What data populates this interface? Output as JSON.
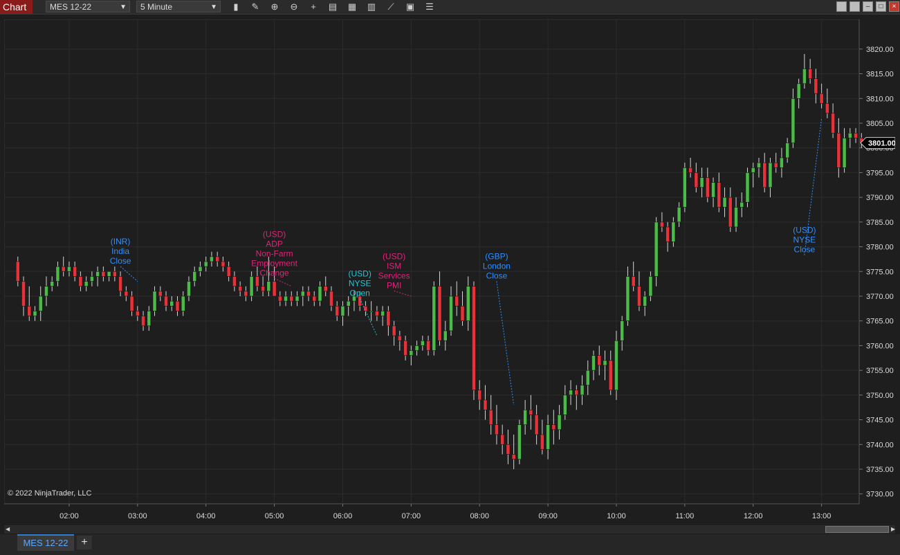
{
  "toolbar": {
    "title": "Chart",
    "instrument": "MES 12-22",
    "interval": "5 Minute"
  },
  "icons": [
    "bar-type-icon",
    "pencil-icon",
    "zoom-in-icon",
    "zoom-out-icon",
    "crosshair-icon",
    "properties-icon",
    "templates-icon",
    "indicators-icon",
    "strategies-icon",
    "data-box-icon",
    "list-icon"
  ],
  "chart_data": {
    "type": "candlestick",
    "instrument": "MES 12-22",
    "interval": "5 Minute",
    "current_price": "3801.00",
    "copyright": "© 2022 NinjaTrader, LLC",
    "ylim": [
      3728,
      3826
    ],
    "y_ticks": [
      "3730.00",
      "3735.00",
      "3740.00",
      "3745.00",
      "3750.00",
      "3755.00",
      "3760.00",
      "3765.00",
      "3770.00",
      "3775.00",
      "3780.00",
      "3785.00",
      "3790.00",
      "3795.00",
      "3800.00",
      "3805.00",
      "3810.00",
      "3815.00",
      "3820.00"
    ],
    "x_ticks": [
      "02:00",
      "03:00",
      "04:00",
      "05:00",
      "06:00",
      "07:00",
      "08:00",
      "09:00",
      "10:00",
      "11:00",
      "12:00",
      "13:00"
    ],
    "x_tick_times": [
      2,
      3,
      4,
      5,
      6,
      7,
      8,
      9,
      10,
      11,
      12,
      13
    ],
    "first_bar_time": 1.25,
    "bar_minutes": 5,
    "grid": true,
    "candles": [
      [
        3777,
        3778,
        3772,
        3773
      ],
      [
        3773,
        3774,
        3766,
        3768
      ],
      [
        3768,
        3772,
        3765,
        3766
      ],
      [
        3766,
        3768,
        3765,
        3767
      ],
      [
        3767,
        3772,
        3765,
        3770
      ],
      [
        3770,
        3774,
        3768,
        3772
      ],
      [
        3772,
        3774,
        3771,
        3773
      ],
      [
        3773,
        3777,
        3772,
        3776
      ],
      [
        3776,
        3778,
        3774,
        3775
      ],
      [
        3775,
        3777,
        3774,
        3776
      ],
      [
        3776,
        3777,
        3773,
        3774
      ],
      [
        3774,
        3775,
        3771,
        3772
      ],
      [
        3772,
        3774,
        3771,
        3773
      ],
      [
        3773,
        3775,
        3772,
        3774
      ],
      [
        3774,
        3776,
        3772,
        3775
      ],
      [
        3775,
        3776,
        3773,
        3774
      ],
      [
        3774,
        3775,
        3773,
        3775
      ],
      [
        3775,
        3776,
        3773,
        3774
      ],
      [
        3774,
        3775,
        3770,
        3771
      ],
      [
        3771,
        3772,
        3769,
        3770
      ],
      [
        3770,
        3771,
        3766,
        3767
      ],
      [
        3767,
        3768,
        3765,
        3766
      ],
      [
        3766,
        3767,
        3763,
        3764
      ],
      [
        3764,
        3768,
        3763,
        3767
      ],
      [
        3767,
        3772,
        3766,
        3771
      ],
      [
        3771,
        3772,
        3769,
        3770
      ],
      [
        3770,
        3771,
        3767,
        3768
      ],
      [
        3768,
        3770,
        3767,
        3769
      ],
      [
        3769,
        3770,
        3766,
        3767
      ],
      [
        3767,
        3771,
        3766,
        3770
      ],
      [
        3770,
        3774,
        3769,
        3773
      ],
      [
        3773,
        3776,
        3772,
        3775
      ],
      [
        3775,
        3777,
        3774,
        3776
      ],
      [
        3776,
        3778,
        3775,
        3777
      ],
      [
        3777,
        3779,
        3776,
        3778
      ],
      [
        3778,
        3779,
        3776,
        3777
      ],
      [
        3777,
        3778,
        3775,
        3776
      ],
      [
        3776,
        3777,
        3773,
        3774
      ],
      [
        3774,
        3775,
        3771,
        3772
      ],
      [
        3772,
        3773,
        3770,
        3771
      ],
      [
        3771,
        3772,
        3769,
        3770
      ],
      [
        3770,
        3775,
        3769,
        3774
      ],
      [
        3774,
        3776,
        3771,
        3772
      ],
      [
        3772,
        3774,
        3770,
        3771
      ],
      [
        3771,
        3778,
        3770,
        3773
      ],
      [
        3773,
        3776,
        3770,
        3770
      ],
      [
        3770,
        3771,
        3768,
        3769
      ],
      [
        3769,
        3771,
        3768,
        3770
      ],
      [
        3770,
        3771,
        3768,
        3769
      ],
      [
        3769,
        3771,
        3768,
        3770
      ],
      [
        3770,
        3772,
        3768,
        3771
      ],
      [
        3771,
        3772,
        3769,
        3770
      ],
      [
        3770,
        3771,
        3768,
        3769
      ],
      [
        3769,
        3773,
        3768,
        3772
      ],
      [
        3772,
        3774,
        3770,
        3771
      ],
      [
        3771,
        3772,
        3767,
        3768
      ],
      [
        3768,
        3769,
        3765,
        3766
      ],
      [
        3766,
        3769,
        3764,
        3768
      ],
      [
        3768,
        3770,
        3766,
        3769
      ],
      [
        3769,
        3771,
        3767,
        3770
      ],
      [
        3770,
        3771,
        3767,
        3768
      ],
      [
        3768,
        3769,
        3766,
        3767
      ],
      [
        3767,
        3769,
        3765,
        3767
      ],
      [
        3767,
        3768,
        3765,
        3766
      ],
      [
        3766,
        3768,
        3764,
        3767
      ],
      [
        3767,
        3768,
        3762,
        3764
      ],
      [
        3764,
        3765,
        3760,
        3762
      ],
      [
        3762,
        3763,
        3759,
        3761
      ],
      [
        3761,
        3762,
        3757,
        3758
      ],
      [
        3758,
        3760,
        3756,
        3759
      ],
      [
        3759,
        3761,
        3758,
        3760
      ],
      [
        3760,
        3762,
        3759,
        3761
      ],
      [
        3761,
        3762,
        3758,
        3759
      ],
      [
        3759,
        3773,
        3758,
        3772
      ],
      [
        3772,
        3775,
        3760,
        3761
      ],
      [
        3761,
        3765,
        3759,
        3763
      ],
      [
        3763,
        3772,
        3762,
        3770
      ],
      [
        3770,
        3773,
        3766,
        3768
      ],
      [
        3768,
        3771,
        3764,
        3765
      ],
      [
        3765,
        3774,
        3763,
        3772
      ],
      [
        3772,
        3773,
        3749,
        3751
      ],
      [
        3751,
        3753,
        3747,
        3749
      ],
      [
        3749,
        3752,
        3745,
        3747
      ],
      [
        3747,
        3750,
        3742,
        3744
      ],
      [
        3744,
        3748,
        3740,
        3742
      ],
      [
        3742,
        3744,
        3738,
        3740
      ],
      [
        3740,
        3743,
        3736,
        3738
      ],
      [
        3738,
        3742,
        3735,
        3737
      ],
      [
        3737,
        3745,
        3736,
        3744
      ],
      [
        3744,
        3749,
        3742,
        3747
      ],
      [
        3747,
        3750,
        3743,
        3746
      ],
      [
        3746,
        3748,
        3740,
        3742
      ],
      [
        3742,
        3745,
        3738,
        3739
      ],
      [
        3739,
        3746,
        3737,
        3744
      ],
      [
        3744,
        3747,
        3740,
        3743
      ],
      [
        3743,
        3748,
        3741,
        3746
      ],
      [
        3746,
        3752,
        3745,
        3750
      ],
      [
        3750,
        3753,
        3748,
        3751
      ],
      [
        3751,
        3752,
        3747,
        3750
      ],
      [
        3750,
        3754,
        3748,
        3752
      ],
      [
        3752,
        3757,
        3750,
        3755
      ],
      [
        3755,
        3759,
        3753,
        3758
      ],
      [
        3758,
        3760,
        3754,
        3756
      ],
      [
        3756,
        3759,
        3753,
        3757
      ],
      [
        3757,
        3759,
        3750,
        3751
      ],
      [
        3751,
        3763,
        3749,
        3761
      ],
      [
        3761,
        3766,
        3759,
        3765
      ],
      [
        3765,
        3776,
        3764,
        3774
      ],
      [
        3774,
        3777,
        3771,
        3772
      ],
      [
        3772,
        3775,
        3767,
        3768
      ],
      [
        3768,
        3771,
        3766,
        3770
      ],
      [
        3770,
        3775,
        3769,
        3774
      ],
      [
        3774,
        3786,
        3772,
        3785
      ],
      [
        3785,
        3787,
        3783,
        3784
      ],
      [
        3784,
        3785,
        3779,
        3781
      ],
      [
        3781,
        3786,
        3780,
        3785
      ],
      [
        3785,
        3789,
        3784,
        3788
      ],
      [
        3788,
        3797,
        3787,
        3796
      ],
      [
        3796,
        3798,
        3794,
        3795
      ],
      [
        3795,
        3797,
        3791,
        3792
      ],
      [
        3792,
        3796,
        3790,
        3794
      ],
      [
        3794,
        3796,
        3789,
        3790
      ],
      [
        3790,
        3794,
        3788,
        3793
      ],
      [
        3793,
        3795,
        3787,
        3788
      ],
      [
        3788,
        3792,
        3786,
        3790
      ],
      [
        3790,
        3792,
        3783,
        3784
      ],
      [
        3784,
        3790,
        3783,
        3788
      ],
      [
        3788,
        3791,
        3786,
        3789
      ],
      [
        3789,
        3796,
        3788,
        3795
      ],
      [
        3795,
        3797,
        3792,
        3796
      ],
      [
        3796,
        3798,
        3794,
        3797
      ],
      [
        3797,
        3799,
        3791,
        3792
      ],
      [
        3792,
        3798,
        3790,
        3797
      ],
      [
        3797,
        3799,
        3795,
        3796
      ],
      [
        3796,
        3800,
        3794,
        3798
      ],
      [
        3798,
        3802,
        3797,
        3801
      ],
      [
        3801,
        3812,
        3800,
        3810
      ],
      [
        3810,
        3814,
        3808,
        3813
      ],
      [
        3813,
        3819,
        3812,
        3816
      ],
      [
        3816,
        3818,
        3813,
        3814
      ],
      [
        3814,
        3816,
        3809,
        3811
      ],
      [
        3811,
        3813,
        3808,
        3809
      ],
      [
        3809,
        3812,
        3806,
        3807
      ],
      [
        3807,
        3809,
        3802,
        3803
      ],
      [
        3803,
        3806,
        3794,
        3796
      ],
      [
        3796,
        3804,
        3795,
        3802
      ],
      [
        3802,
        3804,
        3800,
        3803
      ],
      [
        3803,
        3804,
        3801,
        3802
      ],
      [
        3802,
        3803,
        3800,
        3801
      ]
    ],
    "annotations": [
      {
        "label": "(INR)\nIndia\nClose",
        "color": "#2f8fff",
        "time": 2.75,
        "price": 3780.5,
        "tip_time": 3.0,
        "tip_price": 3773
      },
      {
        "label": "(USD)\nADP\nNon-Farm\nEmployment\nChange",
        "color": "#e0237a",
        "time": 5.0,
        "price": 3782,
        "tip_time": 5.25,
        "tip_price": 3772
      },
      {
        "label": "(USD)\nNYSE\nOpen",
        "color": "#22c7d8",
        "time": 6.25,
        "price": 3774,
        "tip_time": 6.5,
        "tip_price": 3762
      },
      {
        "label": "(USD)\nISM\nServices\nPMI",
        "color": "#e0237a",
        "time": 6.75,
        "price": 3777.5,
        "tip_time": 7.0,
        "tip_price": 3770
      },
      {
        "label": "(GBP)\nLondon\nClose",
        "color": "#2f8fff",
        "time": 8.25,
        "price": 3777.5,
        "tip_time": 8.5,
        "tip_price": 3748
      },
      {
        "label": "(USD)\nNYSE\nClose",
        "color": "#2f8fff",
        "time": 12.75,
        "price": 3782.8,
        "tip_time": 13.0,
        "tip_price": 3806
      }
    ],
    "colors": {
      "up": "#4cba49",
      "down": "#e8323a",
      "wick": "#d8d8d8",
      "grid": "#2c2c2c",
      "text": "#dcdcdc",
      "background": "#1e1e1e",
      "price_marker": "#000000"
    }
  },
  "tabs": {
    "active": "MES 12-22",
    "add": "+"
  }
}
